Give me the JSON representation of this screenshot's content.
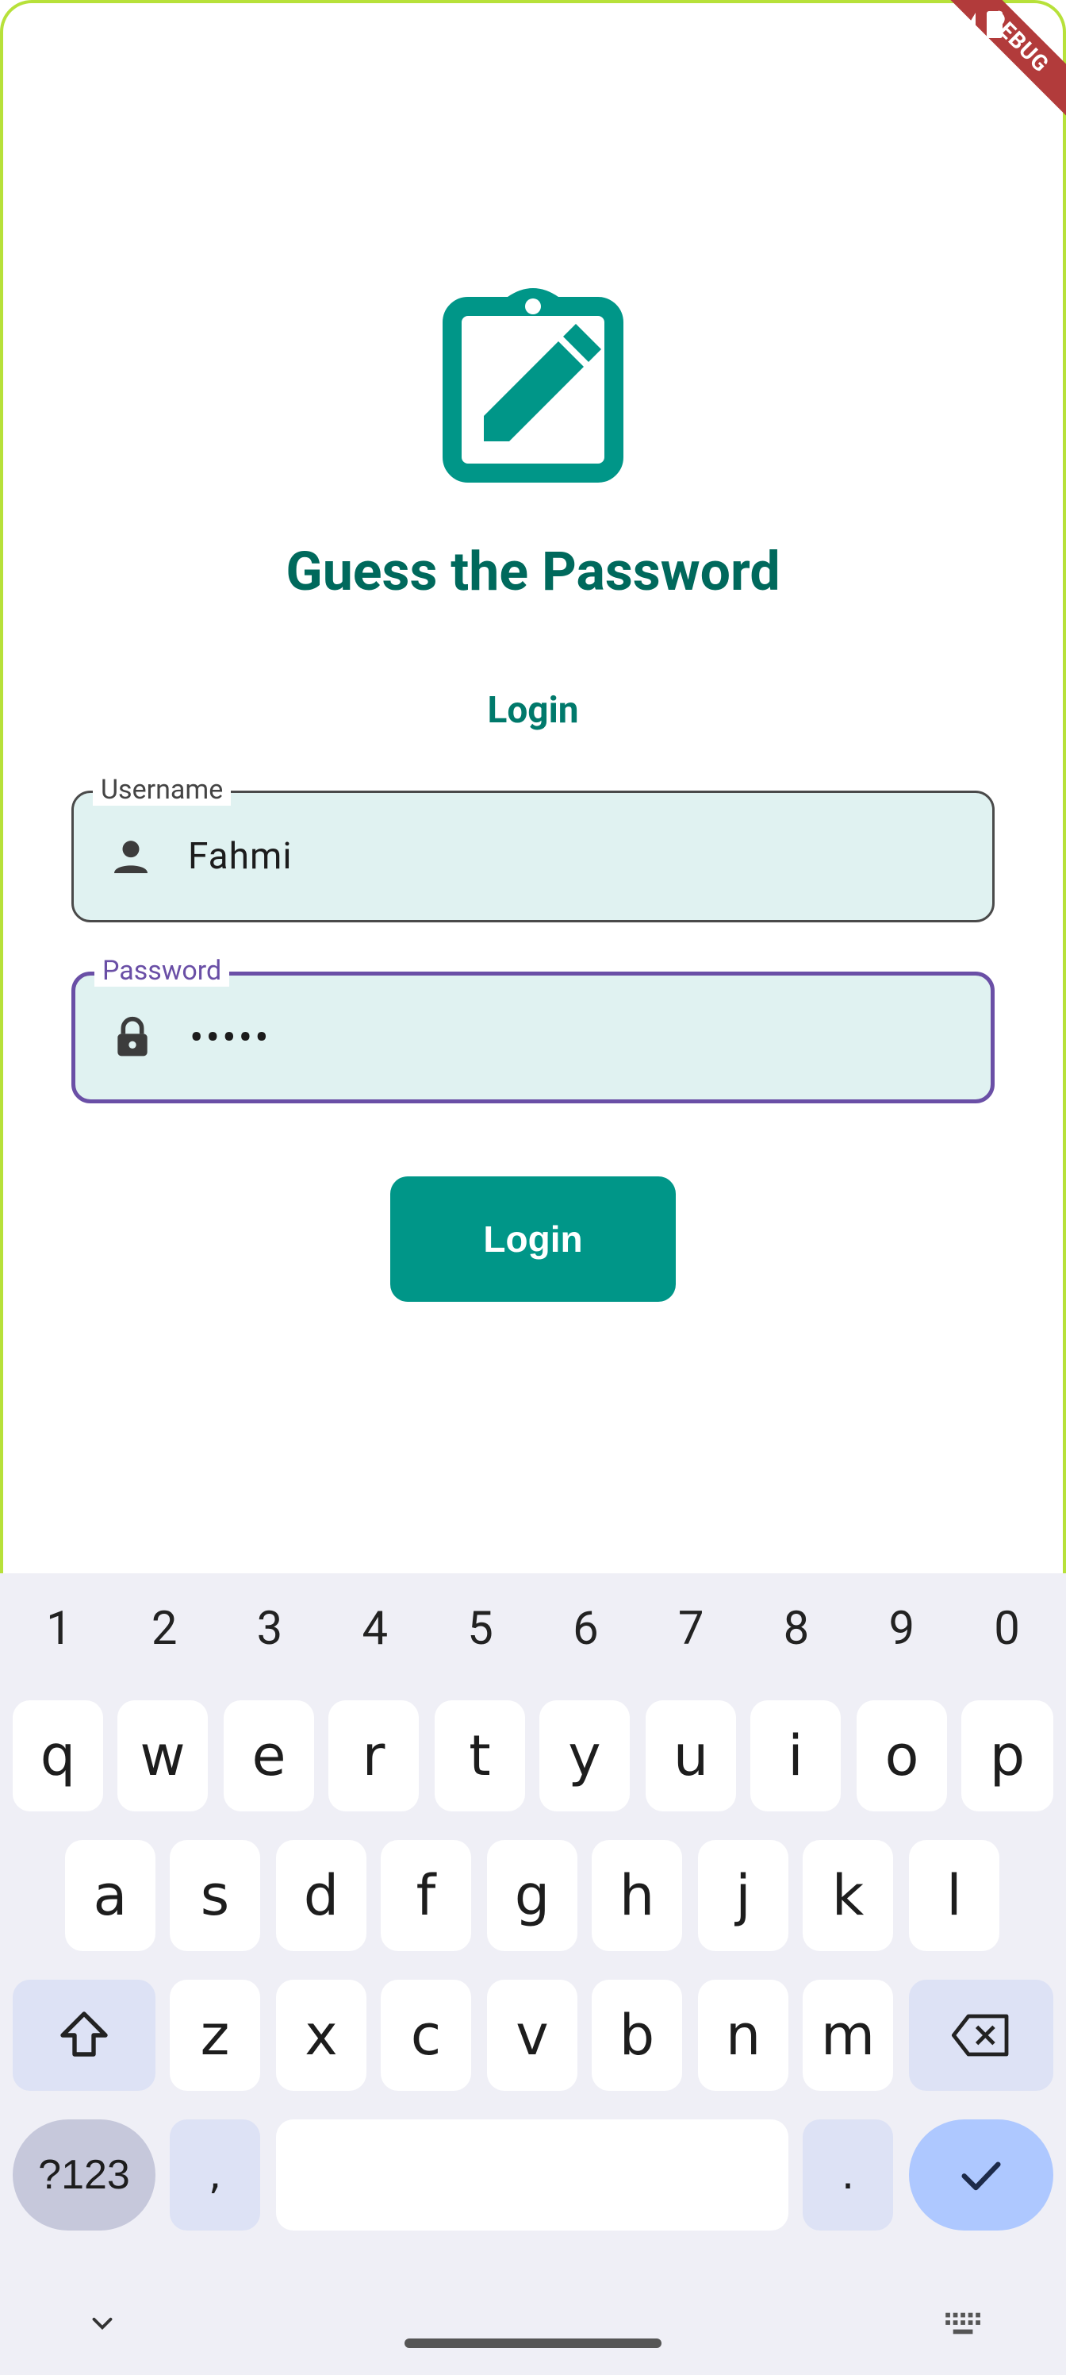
{
  "app": {
    "title": "Guess the Password",
    "section_label": "Login",
    "debug_banner": "DEBUG",
    "primary_color": "#009688",
    "title_color": "#00695c"
  },
  "form": {
    "username": {
      "label": "Username",
      "value": "Fahmi",
      "icon": "person-icon"
    },
    "password": {
      "label": "Password",
      "value": "•••••",
      "icon": "lock-icon",
      "focused": true
    },
    "submit_label": "Login"
  },
  "keyboard": {
    "numbers": [
      "1",
      "2",
      "3",
      "4",
      "5",
      "6",
      "7",
      "8",
      "9",
      "0"
    ],
    "row1": [
      "q",
      "w",
      "e",
      "r",
      "t",
      "y",
      "u",
      "i",
      "o",
      "p"
    ],
    "row2": [
      "a",
      "s",
      "d",
      "f",
      "g",
      "h",
      "j",
      "k",
      "l"
    ],
    "row3": [
      "z",
      "x",
      "c",
      "v",
      "b",
      "n",
      "m"
    ],
    "symbols_label": "?123",
    "comma": ",",
    "period": ".",
    "icons": {
      "shift": "shift-icon",
      "backspace": "backspace-icon",
      "enter": "check-icon",
      "hide": "chevron-down-icon",
      "switch": "keyboard-icon"
    }
  }
}
